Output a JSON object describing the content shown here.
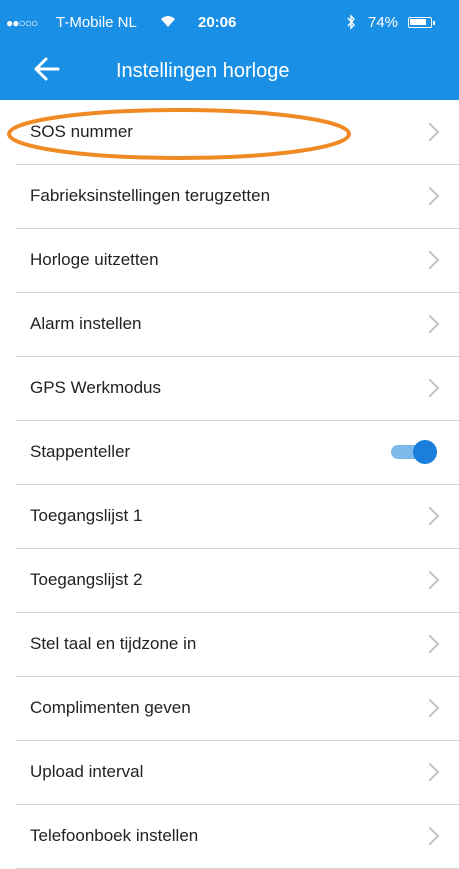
{
  "status_bar": {
    "signal": "●●○○○",
    "carrier": "T-Mobile NL",
    "time": "20:06",
    "battery": "74%"
  },
  "header": {
    "title": "Instellingen horloge"
  },
  "colors": {
    "header_bg": "#1a8fe6",
    "highlight": "#f08a24",
    "toggle_on": "#1a7fdc"
  },
  "settings": [
    {
      "label": "SOS nummer",
      "control": "chevron"
    },
    {
      "label": "Fabrieksinstellingen terugzetten",
      "control": "chevron"
    },
    {
      "label": "Horloge uitzetten",
      "control": "chevron"
    },
    {
      "label": "Alarm instellen",
      "control": "chevron"
    },
    {
      "label": "GPS Werkmodus",
      "control": "chevron"
    },
    {
      "label": "Stappenteller",
      "control": "toggle",
      "on": true
    },
    {
      "label": "Toegangslijst 1",
      "control": "chevron"
    },
    {
      "label": "Toegangslijst 2",
      "control": "chevron"
    },
    {
      "label": "Stel taal en tijdzone in",
      "control": "chevron"
    },
    {
      "label": "Complimenten geven",
      "control": "chevron"
    },
    {
      "label": "Upload interval",
      "control": "chevron"
    },
    {
      "label": "Telefoonboek instellen",
      "control": "chevron"
    }
  ]
}
